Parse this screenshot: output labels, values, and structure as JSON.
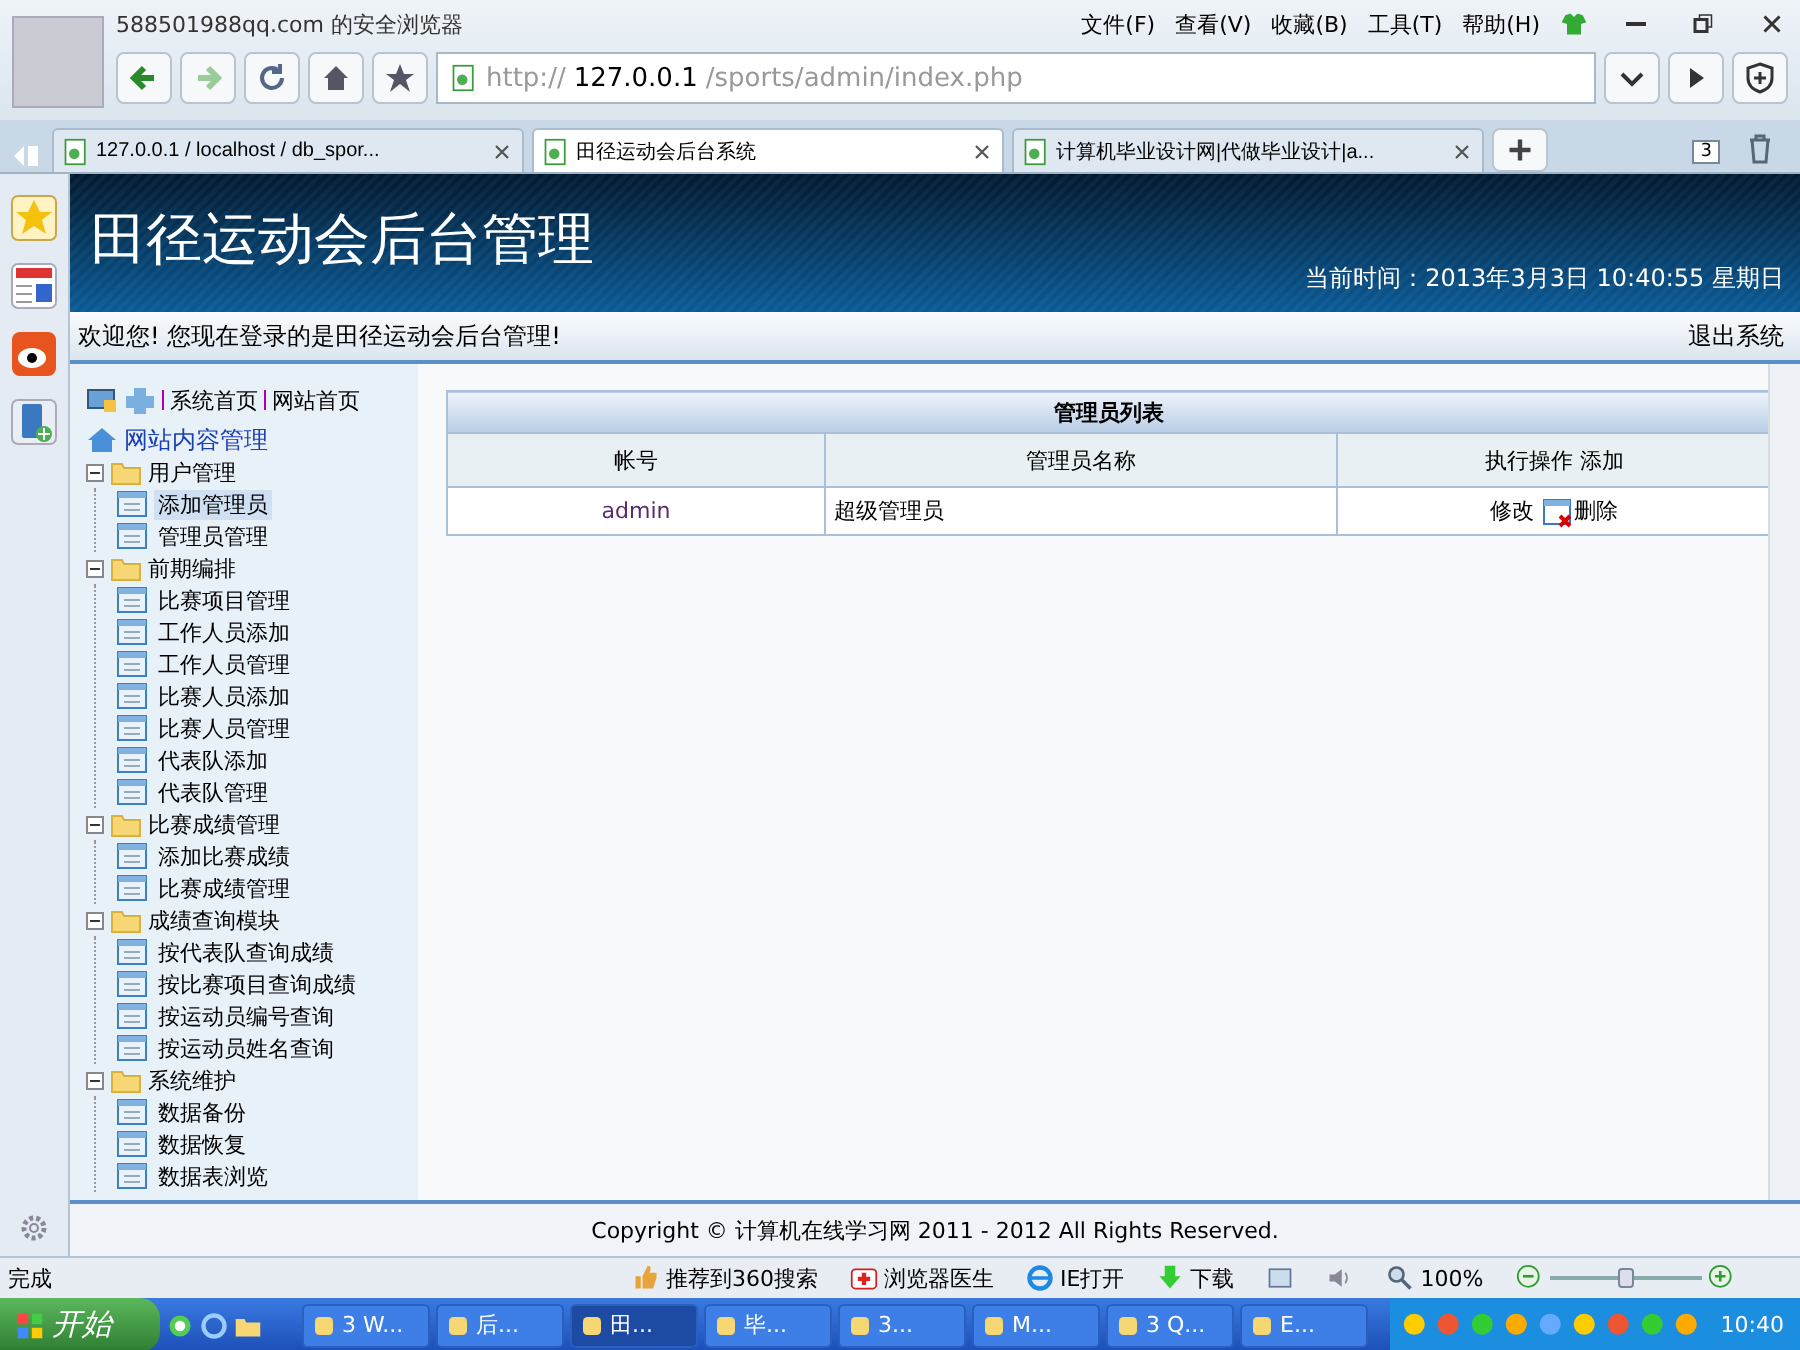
{
  "browser": {
    "account": "588501988qq.com 的安全浏览器",
    "menu": [
      "文件(F)",
      "查看(V)",
      "收藏(B)",
      "工具(T)",
      "帮助(H)"
    ],
    "url": {
      "scheme": "http://",
      "host": "127.0.0.1",
      "path": "/sports/admin/index.php"
    },
    "tabs": [
      {
        "label": "127.0.0.1 / localhost / db_spor...",
        "selected": false
      },
      {
        "label": "田径运动会后台系统",
        "selected": true
      },
      {
        "label": "计算机毕业设计网|代做毕业设计|a...",
        "selected": false
      }
    ],
    "tab_count": "3"
  },
  "header": {
    "title": "田径运动会后台管理",
    "time": "当前时间：2013年3月3日  10:40:55 星期日"
  },
  "welcome": {
    "text": "欢迎您! 您现在登录的是田径运动会后台管理!",
    "logout": "退出系统"
  },
  "sidebar": {
    "links": [
      "系统首页",
      "网站首页"
    ],
    "root": "网站内容管理",
    "tree": [
      {
        "label": "用户管理",
        "expanded": true,
        "children": [
          {
            "label": "添加管理员",
            "selected": true
          },
          {
            "label": "管理员管理",
            "selected": false
          }
        ]
      },
      {
        "label": "前期编排",
        "expanded": true,
        "children": [
          {
            "label": "比赛项目管理",
            "selected": false
          },
          {
            "label": "工作人员添加",
            "selected": false
          },
          {
            "label": "工作人员管理",
            "selected": false
          },
          {
            "label": "比赛人员添加",
            "selected": false
          },
          {
            "label": "比赛人员管理",
            "selected": false
          },
          {
            "label": "代表队添加",
            "selected": false
          },
          {
            "label": "代表队管理",
            "selected": false
          }
        ]
      },
      {
        "label": "比赛成绩管理",
        "expanded": true,
        "children": [
          {
            "label": "添加比赛成绩",
            "selected": false
          },
          {
            "label": "比赛成绩管理",
            "selected": false
          }
        ]
      },
      {
        "label": "成绩查询模块",
        "expanded": true,
        "children": [
          {
            "label": "按代表队查询成绩",
            "selected": false
          },
          {
            "label": "按比赛项目查询成绩",
            "selected": false
          },
          {
            "label": "按运动员编号查询",
            "selected": false
          },
          {
            "label": "按运动员姓名查询",
            "selected": false
          }
        ]
      },
      {
        "label": "系统维护",
        "expanded": true,
        "children": [
          {
            "label": "数据备份",
            "selected": false
          },
          {
            "label": "数据恢复",
            "selected": false
          },
          {
            "label": "数据表浏览",
            "selected": false
          }
        ]
      }
    ]
  },
  "table": {
    "title": "管理员列表",
    "columns": [
      "帐号",
      "管理员名称",
      "执行操作"
    ],
    "add": "添加",
    "rows": [
      {
        "account": "admin",
        "name": "超级管理员",
        "edit": "修改",
        "delete": "删除"
      }
    ]
  },
  "footer": "Copyright © 计算机在线学习网  2011 - 2012 All Rights Reserved.",
  "status_bar": {
    "status": "完成",
    "items": [
      "推荐到360搜索",
      "浏览器医生",
      "IE打开",
      "下载"
    ],
    "zoom": "100%",
    "zoom_slider": {
      "level": 0.5
    }
  },
  "taskbar": {
    "start": "开始",
    "windows": [
      {
        "label": "3 W...",
        "selected": false
      },
      {
        "label": "后...",
        "selected": false
      },
      {
        "label": "田...",
        "selected": true
      },
      {
        "label": "毕...",
        "selected": false
      },
      {
        "label": "3...",
        "selected": false
      },
      {
        "label": "M...",
        "selected": false
      },
      {
        "label": "3 Q...",
        "selected": false
      },
      {
        "label": "E...",
        "selected": false
      }
    ],
    "clock": "10:40"
  }
}
